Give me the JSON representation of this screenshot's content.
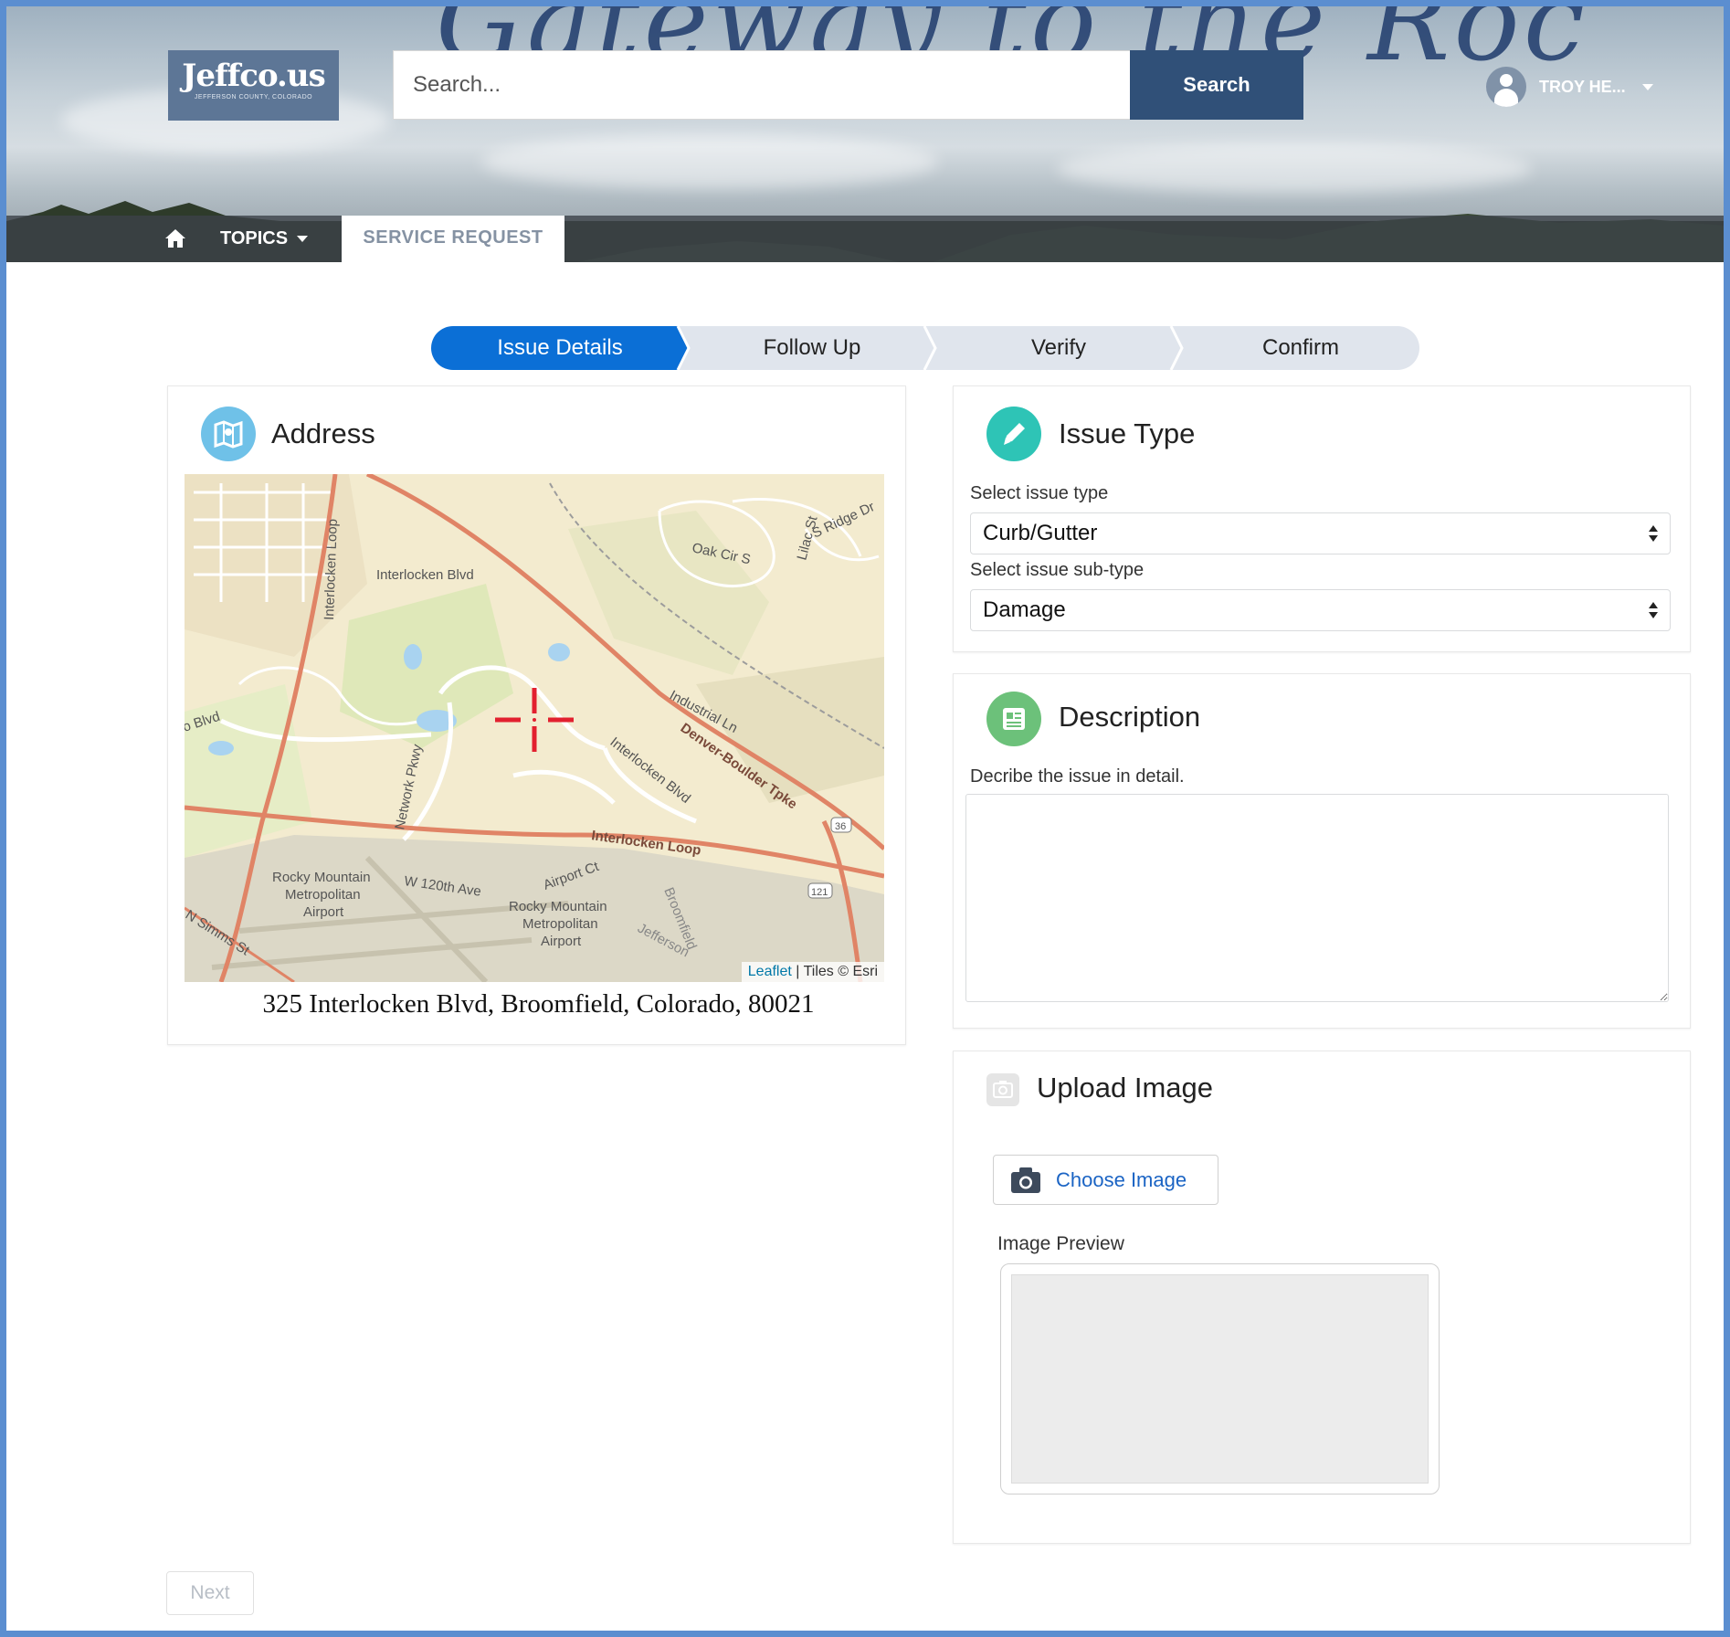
{
  "header": {
    "hero_text": "Gateway to the Roc",
    "logo_main": "Jeffco.us",
    "logo_sub": "JEFFERSON COUNTY, COLORADO",
    "search_placeholder": "Search...",
    "search_button": "Search",
    "user_name": "TROY HE..."
  },
  "nav": {
    "home_icon": "home-icon",
    "topics": "TOPICS",
    "service_request": "SERVICE REQUEST"
  },
  "progress": {
    "steps": [
      "Issue Details",
      "Follow Up",
      "Verify",
      "Confirm"
    ],
    "active_index": 0
  },
  "address": {
    "title": "Address",
    "icon": "map-icon",
    "map_labels": {
      "interlocken_loop_v": "Interlocken Loop",
      "interlocken_blvd_1": "Interlocken Blvd",
      "oak_cir": "Oak Cir S",
      "lilac": "Lilac St",
      "ridge": "S Ridge Dr",
      "o_blvd": "o Blvd",
      "industrial": "Industrial Ln",
      "denver_boulder": "Denver-Boulder Tpke",
      "network": "Network Pkwy",
      "interlocken_blvd_2": "Interlocken Blvd",
      "interlocken_loop_h": "Interlocken Loop",
      "hwy36": "36",
      "hwy121": "121",
      "airport1": "Rocky Mountain",
      "airport1b": "Metropolitan",
      "airport1c": "Airport",
      "w120": "W 120th Ave",
      "airport_ct": "Airport Ct",
      "airport2": "Rocky Mountain",
      "airport2b": "Metropolitan",
      "airport2c": "Airport",
      "broomfield": "Broomfield",
      "jefferson": "Jefferson",
      "simms": "N Simms St"
    },
    "attribution_link": "Leaflet",
    "attribution_rest": "| Tiles © Esri",
    "address_text": "325 Interlocken Blvd, Broomfield, Colorado, 80021"
  },
  "issue_type": {
    "title": "Issue Type",
    "icon": "pencil-icon",
    "type_label": "Select issue type",
    "type_value": "Curb/Gutter",
    "subtype_label": "Select issue sub-type",
    "subtype_value": "Damage"
  },
  "description": {
    "title": "Description",
    "icon": "document-icon",
    "label": "Decribe the issue in detail.",
    "value": ""
  },
  "upload": {
    "title": "Upload Image",
    "icon": "camera-icon",
    "choose_button": "Choose Image",
    "preview_label": "Image Preview"
  },
  "footer": {
    "next_button": "Next"
  },
  "colors": {
    "brand_dark_blue": "#305078",
    "active_step": "#0b6fd6",
    "inactive_step": "#e0e5ed",
    "pencil_icon": "#2ec4b6",
    "description_icon": "#6cc17a",
    "map_icon": "#6fc1e8"
  }
}
